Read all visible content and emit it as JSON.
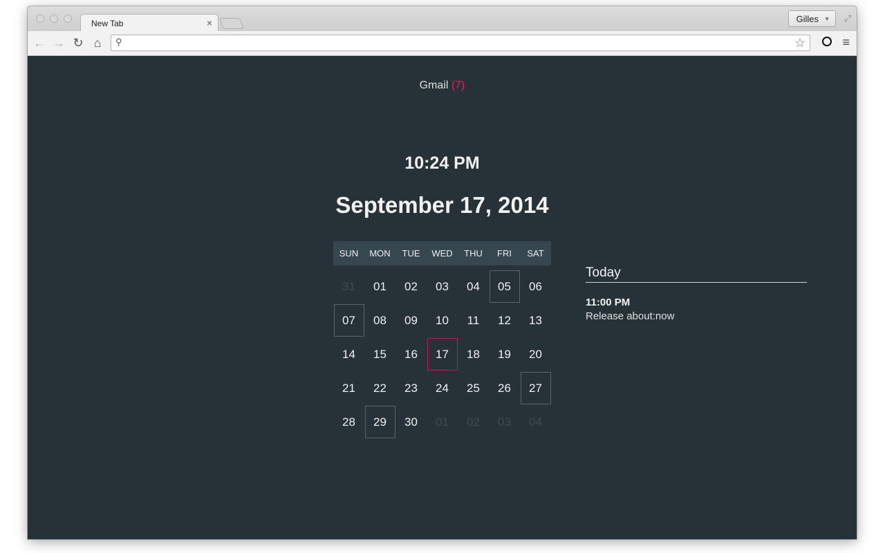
{
  "browser": {
    "tab_title": "New Tab",
    "tab_close": "×",
    "profile_name": "Gilles",
    "omnibox": {
      "value": "",
      "placeholder": ""
    },
    "icons": [
      "back-icon",
      "forward-icon",
      "reload-icon",
      "home-icon",
      "search-icon",
      "star-icon",
      "extension-icon",
      "menu-icon"
    ]
  },
  "page": {
    "gmail_label": "Gmail",
    "gmail_count": "(7)",
    "time": "10:24 PM",
    "date": "September 17, 2014"
  },
  "calendar": {
    "weekdays": [
      "SUN",
      "MON",
      "TUE",
      "WED",
      "THU",
      "FRI",
      "SAT"
    ],
    "days": [
      {
        "d": "31",
        "muted": true
      },
      {
        "d": "01"
      },
      {
        "d": "02"
      },
      {
        "d": "03"
      },
      {
        "d": "04"
      },
      {
        "d": "05",
        "event": true
      },
      {
        "d": "06"
      },
      {
        "d": "07",
        "event": true
      },
      {
        "d": "08"
      },
      {
        "d": "09"
      },
      {
        "d": "10"
      },
      {
        "d": "11"
      },
      {
        "d": "12"
      },
      {
        "d": "13"
      },
      {
        "d": "14"
      },
      {
        "d": "15"
      },
      {
        "d": "16"
      },
      {
        "d": "17",
        "today": true
      },
      {
        "d": "18"
      },
      {
        "d": "19"
      },
      {
        "d": "20"
      },
      {
        "d": "21"
      },
      {
        "d": "22"
      },
      {
        "d": "23"
      },
      {
        "d": "24"
      },
      {
        "d": "25"
      },
      {
        "d": "26"
      },
      {
        "d": "27",
        "event": true
      },
      {
        "d": "28"
      },
      {
        "d": "29",
        "event": true
      },
      {
        "d": "30"
      },
      {
        "d": "01",
        "muted": true
      },
      {
        "d": "02",
        "muted": true
      },
      {
        "d": "03",
        "muted": true
      },
      {
        "d": "04",
        "muted": true
      }
    ]
  },
  "agenda": {
    "title": "Today",
    "events": [
      {
        "time": "11:00 PM",
        "title": "Release about:now"
      }
    ]
  },
  "colors": {
    "background": "#263238",
    "header_bg": "#37474f",
    "accent": "#e91e63"
  }
}
